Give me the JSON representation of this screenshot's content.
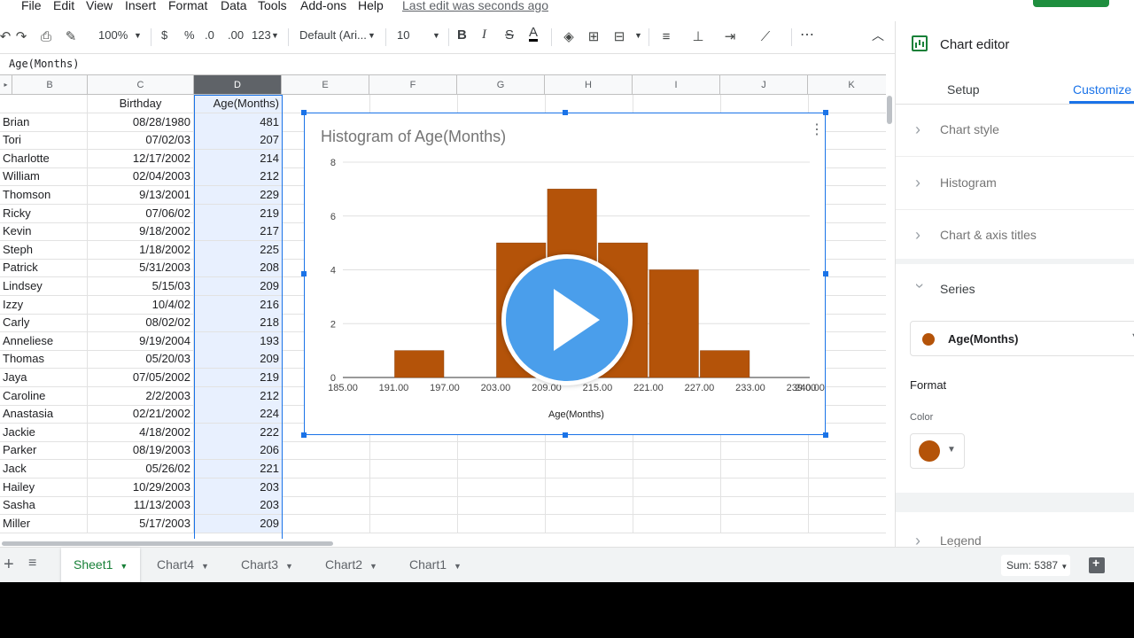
{
  "menu": {
    "items": [
      "File",
      "Edit",
      "View",
      "Insert",
      "Format",
      "Data",
      "Tools",
      "Add-ons",
      "Help"
    ],
    "last_edit": "Last edit was seconds ago"
  },
  "toolbar": {
    "zoom": "100%",
    "currency": "$",
    "percent": "%",
    "decimal_decrease": ".0",
    "decimal_increase": ".00",
    "more_formats": "123",
    "font": "Default (Ari...",
    "font_size": "10",
    "bold": "B",
    "italic": "I",
    "strike": "S",
    "text_color": "A",
    "more": "⋯"
  },
  "formula_bar": {
    "content": "Age(Months)"
  },
  "grid": {
    "columns": [
      "B",
      "C",
      "D",
      "E",
      "F",
      "G",
      "H",
      "I",
      "J",
      "K"
    ],
    "selected_column": "D",
    "header_row": [
      "",
      "Birthday",
      "Age(Months)"
    ],
    "rows": [
      [
        "Brian",
        "08/28/1980",
        "481"
      ],
      [
        "Tori",
        "07/02/03",
        "207"
      ],
      [
        "Charlotte",
        "12/17/2002",
        "214"
      ],
      [
        "William",
        "02/04/2003",
        "212"
      ],
      [
        "Thomson",
        "9/13/2001",
        "229"
      ],
      [
        "Ricky",
        "07/06/02",
        "219"
      ],
      [
        "Kevin",
        "9/18/2002",
        "217"
      ],
      [
        "Steph",
        "1/18/2002",
        "225"
      ],
      [
        "Patrick",
        "5/31/2003",
        "208"
      ],
      [
        "Lindsey",
        "5/15/03",
        "209"
      ],
      [
        "Izzy",
        "10/4/02",
        "216"
      ],
      [
        "Carly",
        "08/02/02",
        "218"
      ],
      [
        "Anneliese",
        "9/19/2004",
        "193"
      ],
      [
        "Thomas",
        "05/20/03",
        "209"
      ],
      [
        "Jaya",
        "07/05/2002",
        "219"
      ],
      [
        "Caroline",
        "2/2/2003",
        "212"
      ],
      [
        "Anastasia",
        "02/21/2002",
        "224"
      ],
      [
        "Jackie",
        "4/18/2002",
        "222"
      ],
      [
        "Parker",
        "08/19/2003",
        "206"
      ],
      [
        "Jack",
        "05/26/02",
        "221"
      ],
      [
        "Hailey",
        "10/29/2003",
        "203"
      ],
      [
        "Sasha",
        "11/13/2003",
        "203"
      ],
      [
        "Miller",
        "5/17/2003",
        "209"
      ]
    ]
  },
  "chart_data": {
    "type": "bar",
    "title": "Histogram of Age(Months)",
    "xlabel": "Age(Months)",
    "ylabel": "",
    "x_ticks": [
      "185.00",
      "191.00",
      "197.00",
      "203.00",
      "209.00",
      "215.00",
      "221.00",
      "227.00",
      "233.00",
      "239.00",
      "240.00"
    ],
    "bins": [
      {
        "start": 185,
        "end": 191,
        "count": 0
      },
      {
        "start": 191,
        "end": 197,
        "count": 1
      },
      {
        "start": 197,
        "end": 203,
        "count": 0
      },
      {
        "start": 203,
        "end": 209,
        "count": 5
      },
      {
        "start": 209,
        "end": 215,
        "count": 7
      },
      {
        "start": 215,
        "end": 221,
        "count": 5
      },
      {
        "start": 221,
        "end": 227,
        "count": 4
      },
      {
        "start": 227,
        "end": 233,
        "count": 1
      },
      {
        "start": 233,
        "end": 239,
        "count": 0
      },
      {
        "start": 239,
        "end": 240,
        "count": 0
      }
    ],
    "y_ticks": [
      "0",
      "2",
      "4",
      "6",
      "8"
    ],
    "ylim": [
      0,
      8
    ],
    "grid": true,
    "bar_color": "#b45309",
    "legend": "none"
  },
  "panel": {
    "title": "Chart editor",
    "tabs": [
      "Setup",
      "Customize"
    ],
    "active_tab": "Customize",
    "sections": [
      "Chart style",
      "Histogram",
      "Chart & axis titles",
      "Series"
    ],
    "series_selected": "Age(Months)",
    "series_color": "#b45309",
    "format_label": "Format",
    "color_label": "Color",
    "legend_section": "Legend"
  },
  "sheets": {
    "tabs": [
      "Sheet1",
      "Chart4",
      "Chart3",
      "Chart2",
      "Chart1"
    ],
    "active": "Sheet1",
    "sum": "Sum: 5387"
  },
  "colors": {
    "accent": "#1a73e8",
    "green": "#188038",
    "bar": "#b45309",
    "play": "#4a9eeb"
  }
}
